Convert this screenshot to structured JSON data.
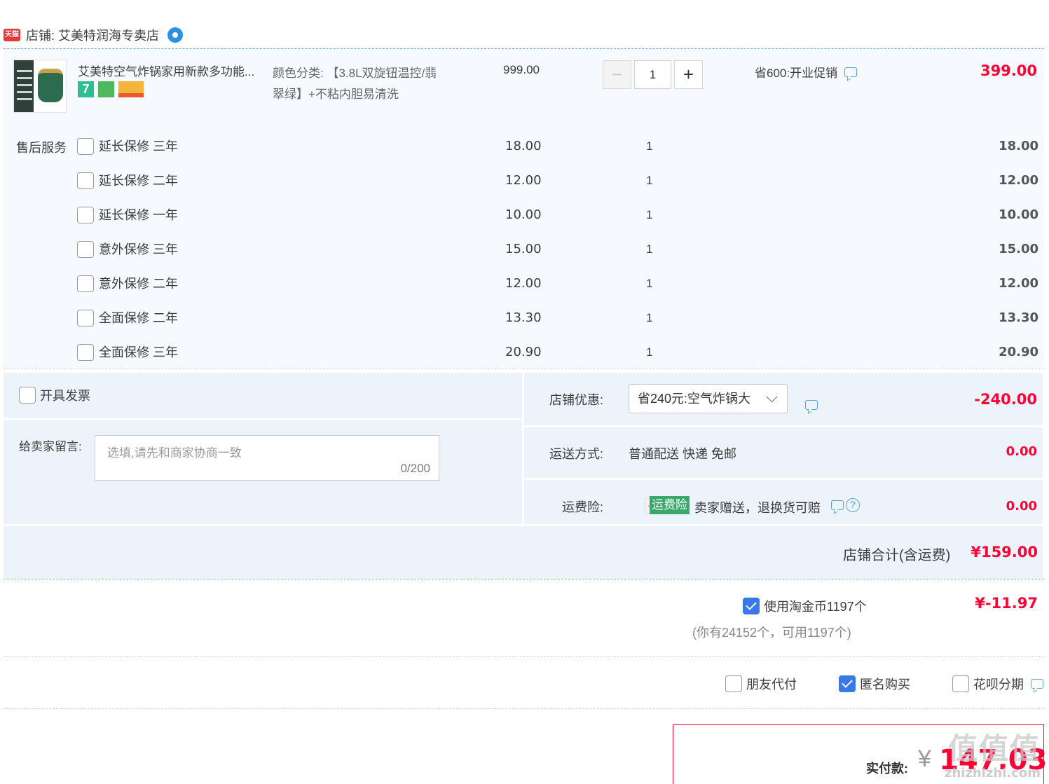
{
  "shop": {
    "tmall_badge": "天猫",
    "label": "店铺: 艾美特润海专卖店"
  },
  "item": {
    "title": "艾美特空气炸锅家用新款多功能...",
    "badge_number": "7",
    "sku_line1": "颜色分类: 【3.8L双旋钮温控/翡",
    "sku_line2": "翠绿】+不粘内胆易清洗",
    "unit_price": "999.00",
    "quantity": "1",
    "promo": "省600:开业促销",
    "total": "399.00"
  },
  "services": {
    "label": "售后服务",
    "rows": [
      {
        "name": "延长保修 三年",
        "price": "18.00",
        "qty": "1",
        "total": "18.00"
      },
      {
        "name": "延长保修 二年",
        "price": "12.00",
        "qty": "1",
        "total": "12.00"
      },
      {
        "name": "延长保修 一年",
        "price": "10.00",
        "qty": "1",
        "total": "10.00"
      },
      {
        "name": "意外保修 三年",
        "price": "15.00",
        "qty": "1",
        "total": "15.00"
      },
      {
        "name": "意外保修 二年",
        "price": "12.00",
        "qty": "1",
        "total": "12.00"
      },
      {
        "name": "全面保修 二年",
        "price": "13.30",
        "qty": "1",
        "total": "13.30"
      },
      {
        "name": "全面保修 三年",
        "price": "20.90",
        "qty": "1",
        "total": "20.90"
      }
    ]
  },
  "invoice": {
    "label": "开具发票"
  },
  "note": {
    "label": "给卖家留言:",
    "placeholder": "选填,请先和商家协商一致",
    "counter": "0/200"
  },
  "discount": {
    "label": "店铺优惠:",
    "selected": "省240元:空气炸锅大",
    "amount": "-240.00"
  },
  "shipping": {
    "label": "运送方式:",
    "value": "普通配送 快递 免邮",
    "amount": "0.00"
  },
  "insurance": {
    "label": "运费险:",
    "tag": "运费险",
    "desc": "卖家赠送，退换货可赔",
    "amount": "0.00"
  },
  "shop_total": {
    "label": "店铺合计(含运费)",
    "amount": "¥159.00"
  },
  "coins": {
    "label": "使用淘金币1197个",
    "sub": "(你有24152个，可用1197个)",
    "amount": "¥-11.97"
  },
  "options": {
    "friend_pay": "朋友代付",
    "anonymous": "匿名购买",
    "huabei": "花呗分期"
  },
  "payment": {
    "label": "实付款:",
    "currency": "¥",
    "amount": "147.03"
  },
  "watermark": {
    "logo": "值值值",
    "url": "zhizhizhi.com"
  },
  "colors": {
    "accent_red": "#ff0036",
    "checkbox_blue": "#3b78e7",
    "panel_bg": "#f6f9fe",
    "insurance_green": "#3aa86b"
  }
}
